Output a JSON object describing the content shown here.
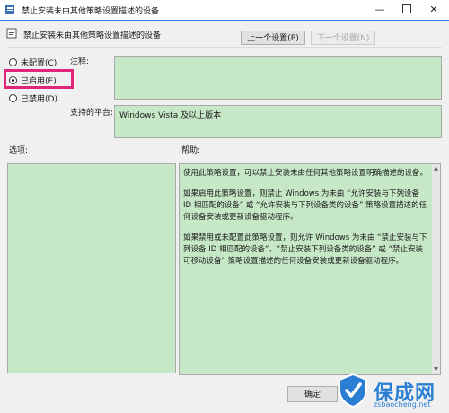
{
  "window": {
    "title": "禁止安装未由其他策略设置描述的设备",
    "minimize_glyph": "—",
    "close_glyph": "✕"
  },
  "header": {
    "policy_name": "禁止安装未由其他策略设置描述的设备",
    "prev_button": "上一个设置(P)",
    "next_button": "下一个设置(N)"
  },
  "state": {
    "options": [
      {
        "label": "未配置(C)",
        "checked": false
      },
      {
        "label": "已启用(E)",
        "checked": true
      },
      {
        "label": "已禁用(D)",
        "checked": false
      }
    ],
    "highlight_color": "#e0267a"
  },
  "comment": {
    "label": "注释:",
    "value": ""
  },
  "platform": {
    "label": "支持的平台:",
    "value": "Windows Vista 及以上版本"
  },
  "options_panel": {
    "label": "选项:"
  },
  "help_panel": {
    "label": "帮助:",
    "paragraphs": [
      "使用此策略设置，可以禁止安装未由任何其他策略设置明确描述的设备。",
      "如果启用此策略设置，则禁止 Windows 为未由 “允许安装与下列设备 ID 相匹配的设备” 或 “允许安装与下列设备类的设备” 策略设置描述的任何设备安装或更新设备驱动程序。",
      "如果禁用或未配置此策略设置，则允许 Windows 为未由 “禁止安装与下列设备 ID 相匹配的设备”、“禁止安装下列设备类的设备” 或 “禁止安装可移动设备” 策略设置描述的任何设备安装或更新设备驱动程序。"
    ]
  },
  "footer": {
    "ok_button": "确定"
  },
  "watermark": {
    "text": "保成网",
    "url": "zsbaocheng.net"
  },
  "colors": {
    "panel_green": "#c7e8c7",
    "accent_blue": "#2b79d8",
    "watermark_blue": "#2a7fd4"
  }
}
